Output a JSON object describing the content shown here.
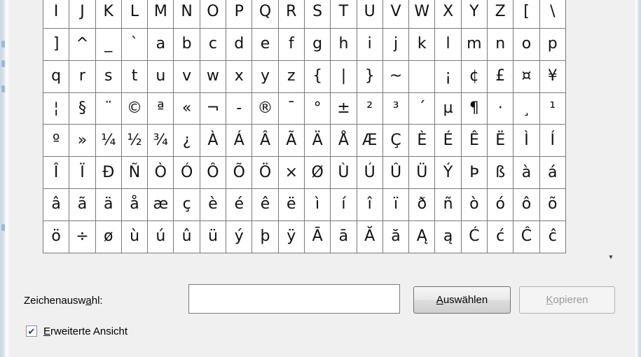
{
  "grid": {
    "rows": [
      [
        "I",
        "J",
        "K",
        "L",
        "M",
        "N",
        "O",
        "P",
        "Q",
        "R",
        "S",
        "T",
        "U",
        "V",
        "W",
        "X",
        "Y",
        "Z",
        "[",
        "\\"
      ],
      [
        "]",
        "^",
        "_",
        "`",
        "a",
        "b",
        "c",
        "d",
        "e",
        "f",
        "g",
        "h",
        "i",
        "j",
        "k",
        "l",
        "m",
        "n",
        "o",
        "p"
      ],
      [
        "q",
        "r",
        "s",
        "t",
        "u",
        "v",
        "w",
        "x",
        "y",
        "z",
        "{",
        "|",
        "}",
        "~",
        "",
        "¡",
        "¢",
        "£",
        "¤",
        "¥"
      ],
      [
        "¦",
        "§",
        "¨",
        "©",
        "ª",
        "«",
        "¬",
        "-",
        "®",
        "¯",
        "°",
        "±",
        "²",
        "³",
        "´",
        "µ",
        "¶",
        "·",
        "¸",
        "¹"
      ],
      [
        "º",
        "»",
        "¼",
        "½",
        "¾",
        "¿",
        "À",
        "Á",
        "Â",
        "Ã",
        "Ä",
        "Å",
        "Æ",
        "Ç",
        "È",
        "É",
        "Ê",
        "Ë",
        "Ì",
        "Í"
      ],
      [
        "Î",
        "Ï",
        "Ð",
        "Ñ",
        "Ò",
        "Ó",
        "Ô",
        "Õ",
        "Ö",
        "×",
        "Ø",
        "Ù",
        "Ú",
        "Û",
        "Ü",
        "Ý",
        "Þ",
        "ß",
        "à",
        "á"
      ],
      [
        "â",
        "ã",
        "ä",
        "å",
        "æ",
        "ç",
        "è",
        "é",
        "ê",
        "ë",
        "ì",
        "í",
        "î",
        "ï",
        "ð",
        "ñ",
        "ò",
        "ó",
        "ô",
        "õ"
      ],
      [
        "ö",
        "÷",
        "ø",
        "ù",
        "ú",
        "û",
        "ü",
        "ý",
        "þ",
        "ÿ",
        "Ā",
        "ā",
        "Ă",
        "ă",
        "Ą",
        "ą",
        "Ć",
        "ć",
        "Ĉ",
        "ĉ"
      ]
    ]
  },
  "scrollbar": {
    "down_arrow_icon": "triangle-down"
  },
  "selection": {
    "label_pre": "Zeichenausw",
    "label_accel": "a",
    "label_post": "hl:",
    "value": ""
  },
  "buttons": {
    "select": {
      "accel": "A",
      "rest": "uswählen"
    },
    "copy": {
      "accel": "K",
      "rest": "opieren",
      "disabled": true
    }
  },
  "advanced_view": {
    "checked": true,
    "accel": "E",
    "rest": "rweiterte Ansicht"
  }
}
